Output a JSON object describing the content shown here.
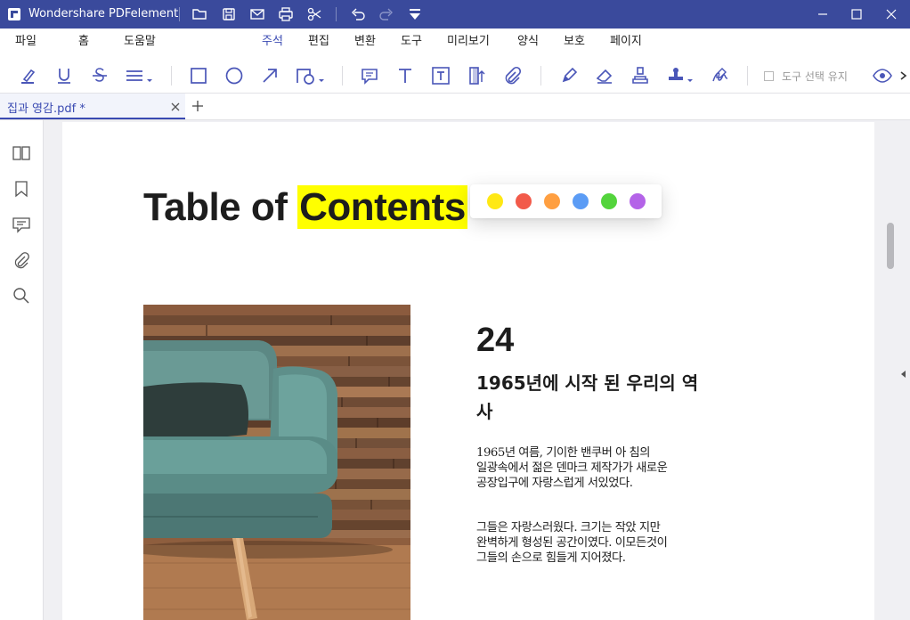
{
  "titlebar": {
    "app_title": "Wondershare PDFelement",
    "quick_icons": [
      "open-folder-icon",
      "save-icon",
      "mail-icon",
      "print-icon",
      "cut-icon",
      "undo-icon",
      "redo-icon",
      "customize-icon"
    ]
  },
  "menu": {
    "items": [
      "파일",
      "홈",
      "도움말",
      "주석",
      "편집",
      "변환",
      "도구",
      "미리보기",
      "양식",
      "보호",
      "페이지"
    ],
    "active": "주석"
  },
  "toolbar": {
    "tools": [
      "highlight-icon",
      "underline-icon",
      "strikethrough-icon",
      "text-align-icon",
      "rectangle-icon",
      "ellipse-icon",
      "arrow-icon",
      "shape-icon",
      "comment-icon",
      "text-icon",
      "textbox-icon",
      "callout-icon",
      "attachment-icon",
      "pencil-icon",
      "eraser-icon",
      "stamp-icon",
      "signature-stamp-icon",
      "sign-icon"
    ],
    "keep_tool_label": "도구 선택 유지"
  },
  "tabs": {
    "active_tab": "집과 영감.pdf *"
  },
  "left_panel": {
    "icons": [
      "thumbnails-icon",
      "bookmark-icon",
      "comments-icon",
      "attachments-icon",
      "search-icon"
    ]
  },
  "document": {
    "heading_prefix": "Table of ",
    "heading_highlight": "Contents",
    "highlight_color": "#ffff00",
    "palette": [
      "#ffe814",
      "#f25a4a",
      "#ff9f40",
      "#5b9cf5",
      "#53d43c",
      "#b463e8"
    ],
    "page_number": "24",
    "subheading": "1965년에 시작 된 우리의 역사",
    "paragraph_1": "1965년 여름, 기이한 밴쿠버 아 침의 일광속에서 젊은 덴마크 제작가가 새로운 공장입구에 자랑스럽게 서있었다.",
    "paragraph_2": "그들은 자랑스러웠다. 크기는 작았 지만 완벽하게 형성된 공간이였다. 이모든것이 그들의 손으로 힘들게 지어졌다."
  },
  "colors": {
    "titlebar": "#3a4a9c",
    "accent": "#3a4ab2"
  }
}
